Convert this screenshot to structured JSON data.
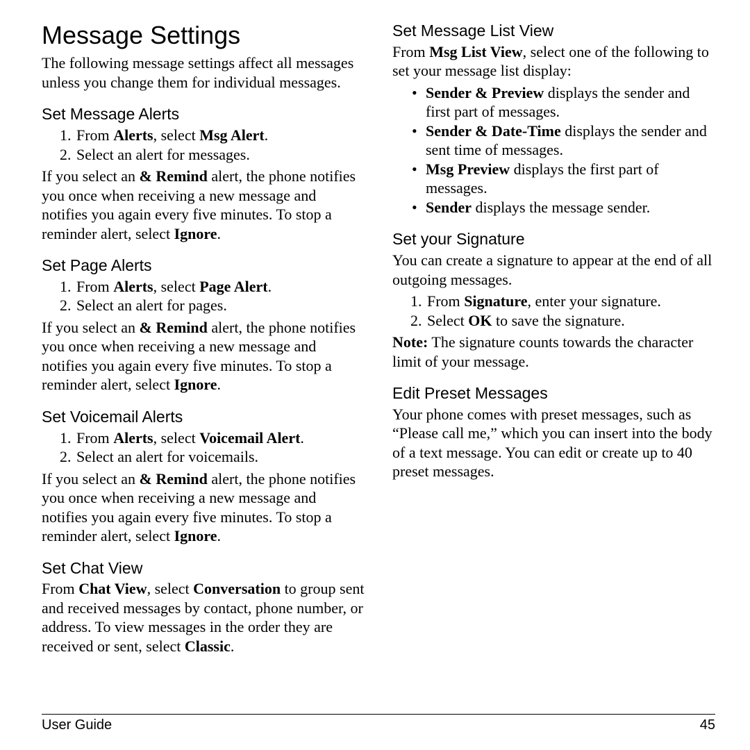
{
  "title": "Message Settings",
  "intro": "The following message settings affect all messages unless you change them for individual messages.",
  "sec_msg_alerts": {
    "heading": "Set Message Alerts",
    "step1_pre": "From ",
    "step1_b1": "Alerts",
    "step1_mid": ", select ",
    "step1_b2": "Msg Alert",
    "step1_post": ".",
    "step2": "Select an alert for messages.",
    "remind_pre": "If you select an ",
    "remind_b": "& Remind",
    "remind_mid": " alert, the phone notifies you once when receiving a new message and notifies you again every five minutes. To stop a reminder alert, select ",
    "remind_b2": "Ignore",
    "remind_post": "."
  },
  "sec_page_alerts": {
    "heading": "Set Page Alerts",
    "step1_pre": "From ",
    "step1_b1": "Alerts",
    "step1_mid": ", select ",
    "step1_b2": "Page Alert",
    "step1_post": ".",
    "step2": "Select an alert for pages.",
    "remind_pre": "If you select an ",
    "remind_b": "& Remind",
    "remind_mid": " alert, the phone notifies you once when receiving a new message and notifies you again every five minutes. To stop a reminder alert, select ",
    "remind_b2": "Ignore",
    "remind_post": "."
  },
  "sec_vm_alerts": {
    "heading": "Set Voicemail Alerts",
    "step1_pre": "From ",
    "step1_b1": "Alerts",
    "step1_mid": ", select ",
    "step1_b2": "Voicemail Alert",
    "step1_post": ".",
    "step2": "Select an alert for voicemails.",
    "remind_pre": "If you select an ",
    "remind_b": "& Remind",
    "remind_mid": " alert, the phone notifies you once when receiving a new message and notifies you again every five minutes. To stop a reminder alert, select ",
    "remind_b2": "Ignore",
    "remind_post": "."
  },
  "sec_chat_view": {
    "heading": "Set Chat View",
    "p_pre": "From ",
    "p_b1": "Chat View",
    "p_mid1": ", select ",
    "p_b2": "Conversation",
    "p_mid2": " to group sent and received messages by contact, phone number, or address. To view messages in the order they are received or sent, select ",
    "p_b3": "Classic",
    "p_post": "."
  },
  "sec_list_view": {
    "heading": "Set Message List View",
    "intro_pre": "From ",
    "intro_b": "Msg List View",
    "intro_post": ", select one of the following to set your message list display:",
    "li1_b": "Sender & Preview",
    "li1_t": " displays the sender and first part of messages.",
    "li2_b": "Sender & Date-Time",
    "li2_t": " displays the sender and sent time of messages.",
    "li3_b": "Msg Preview",
    "li3_t": " displays the first part of messages.",
    "li4_b": "Sender",
    "li4_t": " displays the message sender."
  },
  "sec_signature": {
    "heading": "Set your Signature",
    "intro": "You can create a signature to appear at the end of all outgoing messages.",
    "step1_pre": "From ",
    "step1_b": "Signature",
    "step1_post": ", enter your signature.",
    "step2_pre": "Select ",
    "step2_b": "OK",
    "step2_post": " to save the signature.",
    "note_b": "Note:",
    "note_t": " The signature counts towards the character limit of your message."
  },
  "sec_preset": {
    "heading": "Edit Preset Messages",
    "body": "Your phone comes with preset messages, such as “Please call me,” which you can insert into the body of a text message. You can edit or create up to 40 preset messages."
  },
  "footer": {
    "left": "User Guide",
    "right": "45"
  }
}
